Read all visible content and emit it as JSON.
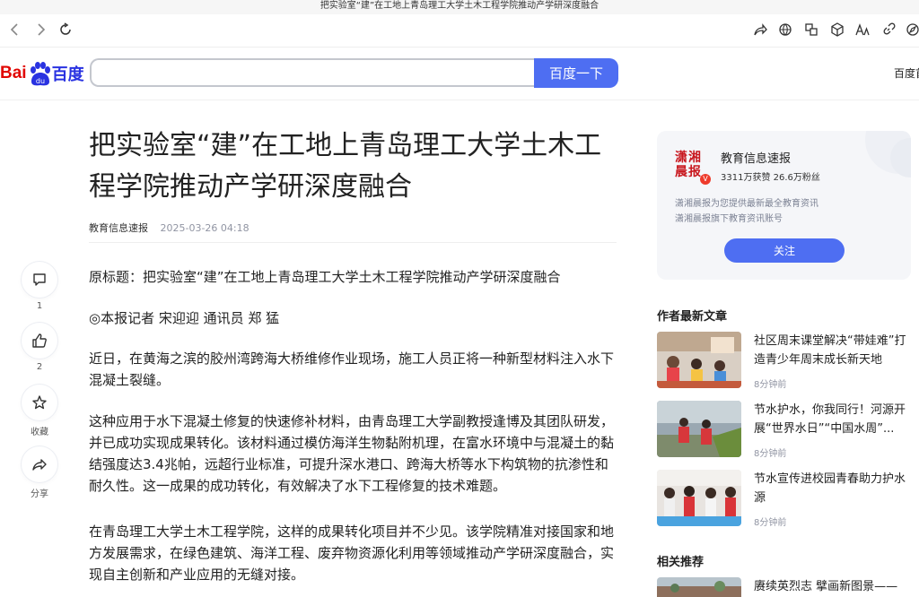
{
  "window": {
    "title": "把实验室“建”在工地上青岛理工大学土木工程学院推动产学研深度融合"
  },
  "toolbar": {
    "icons": [
      "back-icon",
      "forward-icon",
      "reload-icon",
      "share-icon",
      "globe-icon",
      "translate-icon",
      "extension-icon",
      "text-size-icon",
      "link-icon",
      "compass-icon"
    ]
  },
  "header": {
    "logo_bai": "Bai",
    "logo_du": "百度",
    "search_placeholder": "",
    "search_button": "百度一下",
    "right_link": "百度首"
  },
  "article": {
    "title": "把实验室“建”在工地上青岛理工大学土木工程学院推动产学研深度融合",
    "author": "教育信息速报",
    "time": "2025-03-26 04:18",
    "paragraphs": [
      "原标题：把实验室“建”在工地上青岛理工大学土木工程学院推动产学研深度融合",
      "◎本报记者 宋迎迎 通讯员 郑 猛",
      "近日，在黄海之滨的胶州湾跨海大桥维修作业现场，施工人员正将一种新型材料注入水下混凝土裂缝。",
      "这种应用于水下混凝土修复的快速修补材料，由青岛理工大学副教授逢博及其团队研发，并已成功实现成果转化。该材料通过模仿海洋生物黏附机理，在富水环境中与混凝土的黏结强度达3.4兆帕，远超行业标准，可提升深水港口、跨海大桥等水下构筑物的抗渗性和耐久性。这一成果的成功转化，有效解决了水下工程修复的技术难题。",
      "在青岛理工大学土木工程学院，这样的成果转化项目并不少见。该学院精准对接国家和地方发展需求，在绿色建筑、海洋工程、废弃物资源化利用等领域推动产学研深度融合，实现自主创新和产业应用的无缝对接。"
    ]
  },
  "actions": {
    "comment_count": "1",
    "like_count": "2",
    "favorite_label": "收藏",
    "share_label": "分享"
  },
  "author_card": {
    "logo_line1": "潇湘",
    "logo_line2": "晨报",
    "badge": "V",
    "name": "教育信息速报",
    "stats": "3311万获赞 26.6万粉丝",
    "desc_line1": "潇湘晨报为您提供最新最全教育资讯",
    "desc_line2": "潇湘晨报旗下教育资讯账号",
    "follow": "关注"
  },
  "latest": {
    "heading": "作者最新文章",
    "items": [
      {
        "title": "社区周末课堂解决“带娃难”打造青少年周末成长新天地",
        "time": "8分钟前"
      },
      {
        "title": "节水护水，你我同行！河源开展“世界水日”“中国水周”...",
        "time": "8分钟前"
      },
      {
        "title": "节水宣传进校园青春助力护水源",
        "time": "8分钟前"
      }
    ]
  },
  "related": {
    "heading": "相关推荐",
    "items": [
      {
        "title": "赓续英烈志 擘画新图景——"
      }
    ]
  },
  "colors": {
    "accent": "#4e6ef2",
    "brand_red": "#e10602",
    "brand_blue": "#2932e1"
  }
}
